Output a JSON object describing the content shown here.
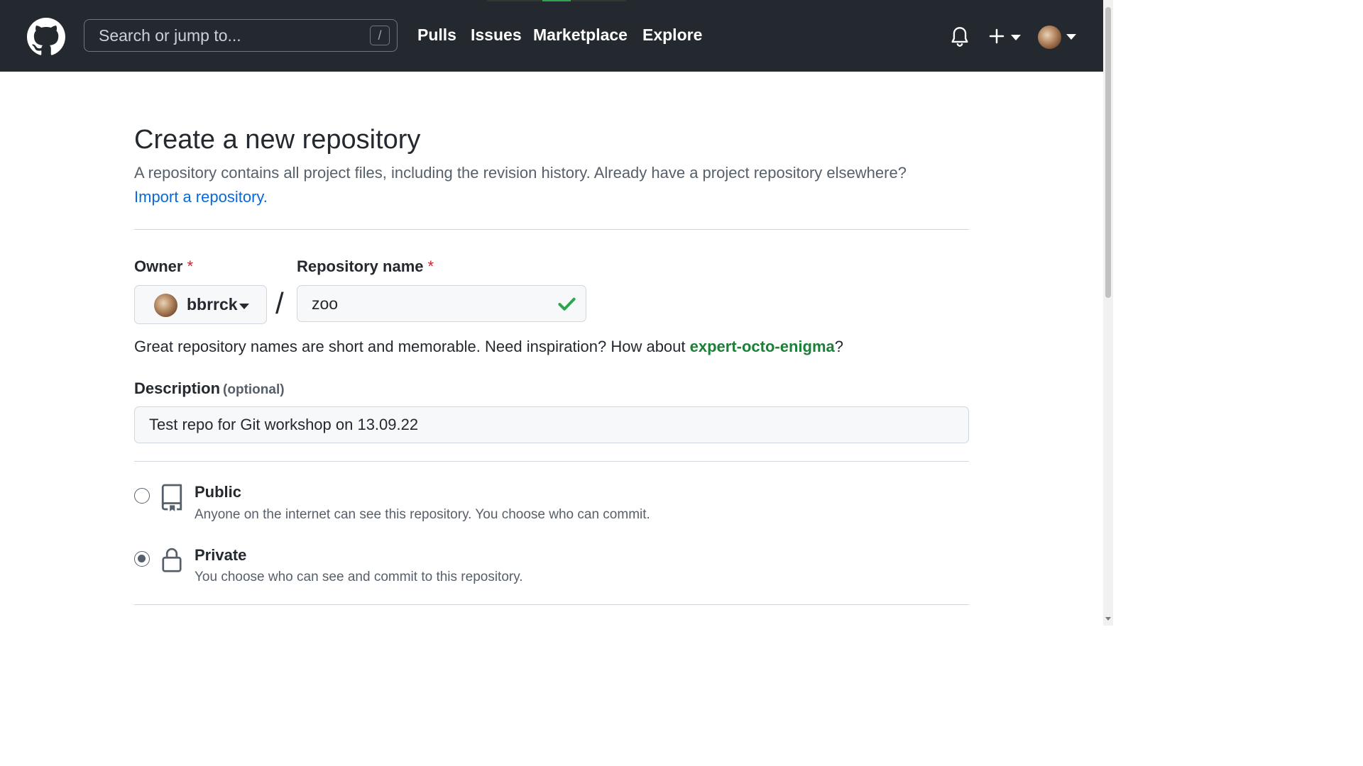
{
  "header": {
    "search_placeholder": "Search or jump to...",
    "search_shortcut": "/",
    "nav": [
      "Pulls",
      "Issues",
      "Marketplace",
      "Explore"
    ]
  },
  "page": {
    "title": "Create a new repository",
    "subtitle": "A repository contains all project files, including the revision history. Already have a project repository elsewhere?",
    "import_link": "Import a repository."
  },
  "form": {
    "owner_label": "Owner",
    "required_mark": "*",
    "owner_value": "bbrrck",
    "separator": "/",
    "repo_label": "Repository name",
    "repo_value": "zoo",
    "hint_prefix": "Great repository names are short and memorable. Need inspiration? How about ",
    "hint_suggestion": "expert-octo-enigma",
    "hint_suffix": "?",
    "description_label": "Description",
    "description_optional": "(optional)",
    "description_value": "Test repo for Git workshop on 13.09.22"
  },
  "visibility": {
    "selected": "Private",
    "options": [
      {
        "title": "Public",
        "description": "Anyone on the internet can see this repository. You choose who can commit."
      },
      {
        "title": "Private",
        "description": "You choose who can see and commit to this repository."
      }
    ]
  },
  "colors": {
    "header_bg": "#24292f",
    "link": "#0969da",
    "success": "#2da44e",
    "required": "#cf222e"
  }
}
